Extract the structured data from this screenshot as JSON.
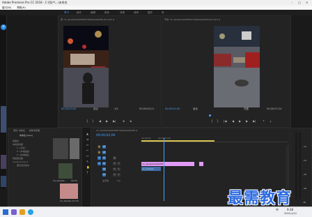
{
  "app": {
    "title": "Adobe Premiere Pro CC 2018 - C:\\用户\\...\\未命名"
  },
  "menu": [
    "窗口(W)",
    "帮助(H)"
  ],
  "workspace_tabs": [
    {
      "label": "学习",
      "active": true
    },
    {
      "label": "组件"
    },
    {
      "label": "编辑"
    },
    {
      "label": "颜色"
    },
    {
      "label": "效果"
    },
    {
      "label": "音频"
    },
    {
      "label": "图形"
    },
    {
      "label": "库"
    }
  ],
  "source_monitor": {
    "title": "源: 1h_1ba4a1b1e6df0fe74bb4e4a09d0f_00.mp4 ≡",
    "timecode_left": "00;00;00;00",
    "fit": "适合",
    "fraction": "1/2",
    "timecode_right": "00;00;00;11"
  },
  "program_monitor": {
    "title": "节目: 1h_1ba4a1b1e6df0fe74bb4e4a09d0f_00.mp4 ≡",
    "timecode_left": "00;00;02;00",
    "fit": "适合",
    "quality": "完整",
    "timecode_right": "00;00;07;24"
  },
  "project_panel": {
    "tabs": [
      "项目: 未命名",
      "媒体浏览器"
    ],
    "path": "未命名.prproj",
    "tree": [
      "收藏夹",
      "本地驱动器",
      "C: (系统)",
      "D: (本地磁盘)",
      "E: (本地磁盘)",
      "网络驱动器",
      "Creative Cloud",
      "团队项目版本"
    ],
    "clips": [
      {
        "name": "1h_1ba4a1...",
        "duration": ""
      },
      {
        "name": "1h_1ba4a1...",
        "duration": "00:23"
      },
      {
        "name": "1h_1ba4a1...",
        "duration": "07:24"
      }
    ]
  },
  "timeline": {
    "title": "1h_1ba4a1b1e6df0fe74bb4e4a09d0f ≡",
    "timecode": "00;00;02;00",
    "ruler": [
      "00;00;00",
      "00;00;02;00",
      "00;00;04;00"
    ],
    "tracks": [
      {
        "name": "V3"
      },
      {
        "name": "V2"
      },
      {
        "name": "V1"
      },
      {
        "name": "A1"
      },
      {
        "name": "A2"
      },
      {
        "name": "A3"
      },
      {
        "name": "主声道",
        "value": "0.0"
      }
    ],
    "clip_v1": "1h_1ba4a1b1e6df0f...",
    "clip_a1": "1h_1ba4a1..."
  },
  "vu": {
    "labels": [
      "-12",
      "-24",
      "-36",
      "-48",
      "dB"
    ]
  },
  "taskbar": {
    "time": "9:38",
    "date": "2021/1/12",
    "lang": "中"
  },
  "watermark": "最需教育",
  "colors": {
    "accent": "#4aa3ff",
    "video_clip": "#e19bf5",
    "audio_clip": "#3f6ea8",
    "watermark": "#2d6be0"
  }
}
